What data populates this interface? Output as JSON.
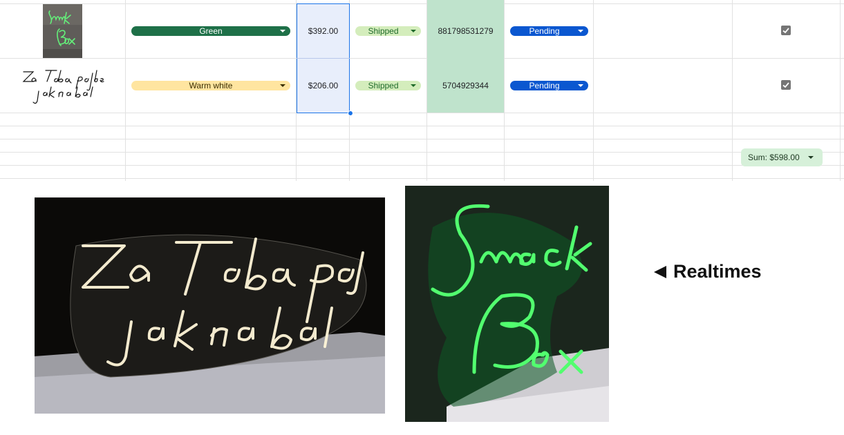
{
  "spreadsheet": {
    "rows": [
      {
        "product_image": "snack-box-neon-thumbnail",
        "color": "Green",
        "price": "$392.00",
        "shipping_status": "Shipped",
        "tracking": "881798531279",
        "payment_status": "Pending",
        "checked": true
      },
      {
        "product_image": "za-toba-pojde-jak-na-bal-script-thumbnail",
        "color": "Warm white",
        "price": "$206.00",
        "shipping_status": "Shipped",
        "tracking": "5704929344",
        "payment_status": "Pending",
        "checked": true
      }
    ],
    "sum_label": "Sum: $598.00"
  },
  "colors": {
    "green_chip": "#1e7048",
    "warm_white_chip": "#ffe5a0",
    "shipped_chip": "#d4edbc",
    "pending_chip": "#0b57d0",
    "tracking_cell": "#bfe3cc",
    "selection": "#1a73e8"
  },
  "caption": {
    "text": "Realtimes"
  },
  "photos": {
    "left": "za-toba-pojde-jak-na-bal-warm-white-neon-photo",
    "right": "snack-box-green-neon-photo"
  }
}
